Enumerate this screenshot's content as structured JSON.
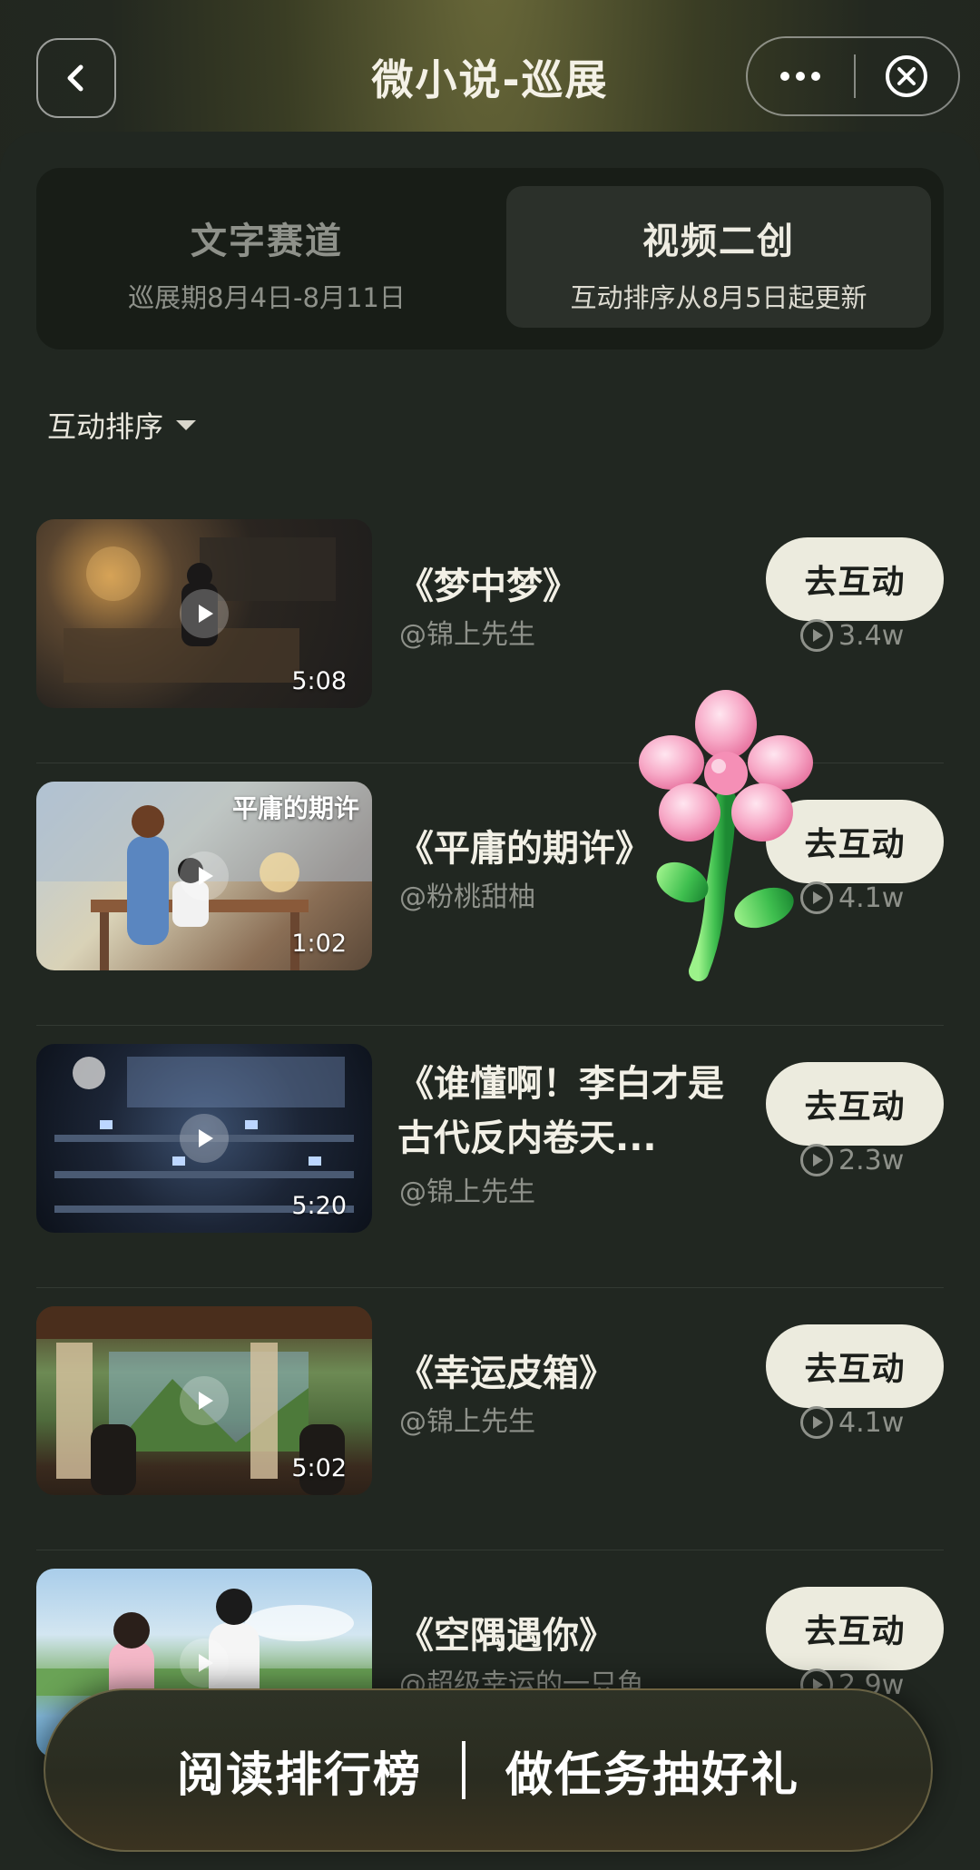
{
  "header": {
    "title": "微小说-巡展"
  },
  "tabs": [
    {
      "name": "文字赛道",
      "sub": "巡展期8月4日-8月11日"
    },
    {
      "name": "视频二创",
      "sub": "互动排序从8月5日起更新"
    }
  ],
  "sort": {
    "label": "互动排序"
  },
  "videos": [
    {
      "title": "《梦中梦》",
      "author": "@锦上先生",
      "duration": "5:08",
      "plays": "3.4w",
      "button": "去互动"
    },
    {
      "title": "《平庸的期许》",
      "author": "@粉桃甜柚",
      "duration": "1:02",
      "plays": "4.1w",
      "button": "去互动"
    },
    {
      "title": "《谁懂啊！李白才是古代反内卷天...",
      "author": "@锦上先生",
      "duration": "5:20",
      "plays": "2.3w",
      "button": "去互动"
    },
    {
      "title": "《幸运皮箱》",
      "author": "@锦上先生",
      "duration": "5:02",
      "plays": "4.1w",
      "button": "去互动"
    },
    {
      "title": "《空隅遇你》",
      "author": "@超级幸运的一只鱼",
      "duration": "",
      "plays": "2.9w",
      "button": "去互动"
    }
  ],
  "thumb_text": {
    "video2": "平庸的期许"
  },
  "bottom_bar": {
    "left": "阅读排行榜",
    "right": "做任务抽好礼"
  },
  "colors": {
    "button_bg": "#ecebde",
    "page_bg": "#212721",
    "accent_pink": "#f4a6c4",
    "stem_green": "#3fbf4f"
  },
  "icons": [
    "back-arrow-icon",
    "more-icon",
    "close-circle-icon",
    "caret-down-icon",
    "play-icon",
    "play-count-icon",
    "flower-sticker"
  ]
}
